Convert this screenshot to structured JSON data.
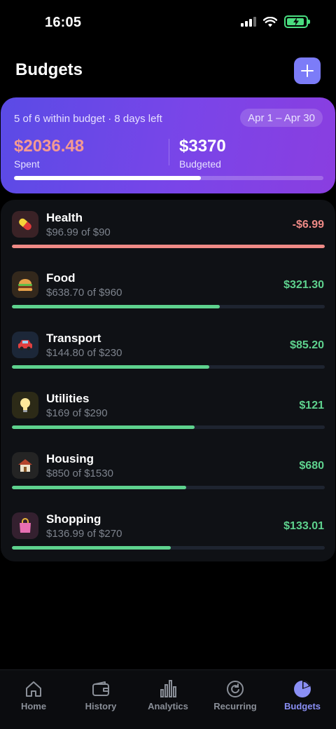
{
  "status_bar": {
    "time": "16:05"
  },
  "header": {
    "title": "Budgets",
    "add_label": "+"
  },
  "summary": {
    "status_text": "5 of 6 within budget · 8 days left",
    "period": "Apr 1 – Apr 30",
    "spent_amount": "$2036.48",
    "spent_label": "Spent",
    "budgeted_amount": "$3370",
    "budgeted_label": "Budgeted",
    "progress_fraction": 0.604,
    "colors": {
      "spent": "#f49a92",
      "gradient_start": "#5a4be6",
      "gradient_end": "#8a3ee0"
    }
  },
  "budgets": [
    {
      "name": "Health",
      "subtitle": "$96.99 of $90",
      "remaining": "-$6.99",
      "progress_fraction": 1.0,
      "over_budget": true,
      "icon": "pill-icon"
    },
    {
      "name": "Food",
      "subtitle": "$638.70 of $960",
      "remaining": "$321.30",
      "progress_fraction": 0.665,
      "over_budget": false,
      "icon": "burger-icon"
    },
    {
      "name": "Transport",
      "subtitle": "$144.80 of $230",
      "remaining": "$85.20",
      "progress_fraction": 0.63,
      "over_budget": false,
      "icon": "car-icon"
    },
    {
      "name": "Utilities",
      "subtitle": "$169 of $290",
      "remaining": "$121",
      "progress_fraction": 0.583,
      "over_budget": false,
      "icon": "lightbulb-icon"
    },
    {
      "name": "Housing",
      "subtitle": "$850 of $1530",
      "remaining": "$680",
      "progress_fraction": 0.556,
      "over_budget": false,
      "icon": "house-icon"
    },
    {
      "name": "Shopping",
      "subtitle": "$136.99 of $270",
      "remaining": "$133.01",
      "progress_fraction": 0.507,
      "over_budget": false,
      "icon": "shopping-bag-icon"
    }
  ],
  "colors": {
    "ok": "#5ed28e",
    "over": "#ef8a86",
    "accent": "#7c7cf8"
  },
  "tabs": [
    {
      "label": "Home",
      "icon": "home-icon",
      "active": false
    },
    {
      "label": "History",
      "icon": "wallet-icon",
      "active": false
    },
    {
      "label": "Analytics",
      "icon": "bar-chart-icon",
      "active": false
    },
    {
      "label": "Recurring",
      "icon": "recurring-icon",
      "active": false
    },
    {
      "label": "Budgets",
      "icon": "pie-chart-icon",
      "active": true
    }
  ]
}
